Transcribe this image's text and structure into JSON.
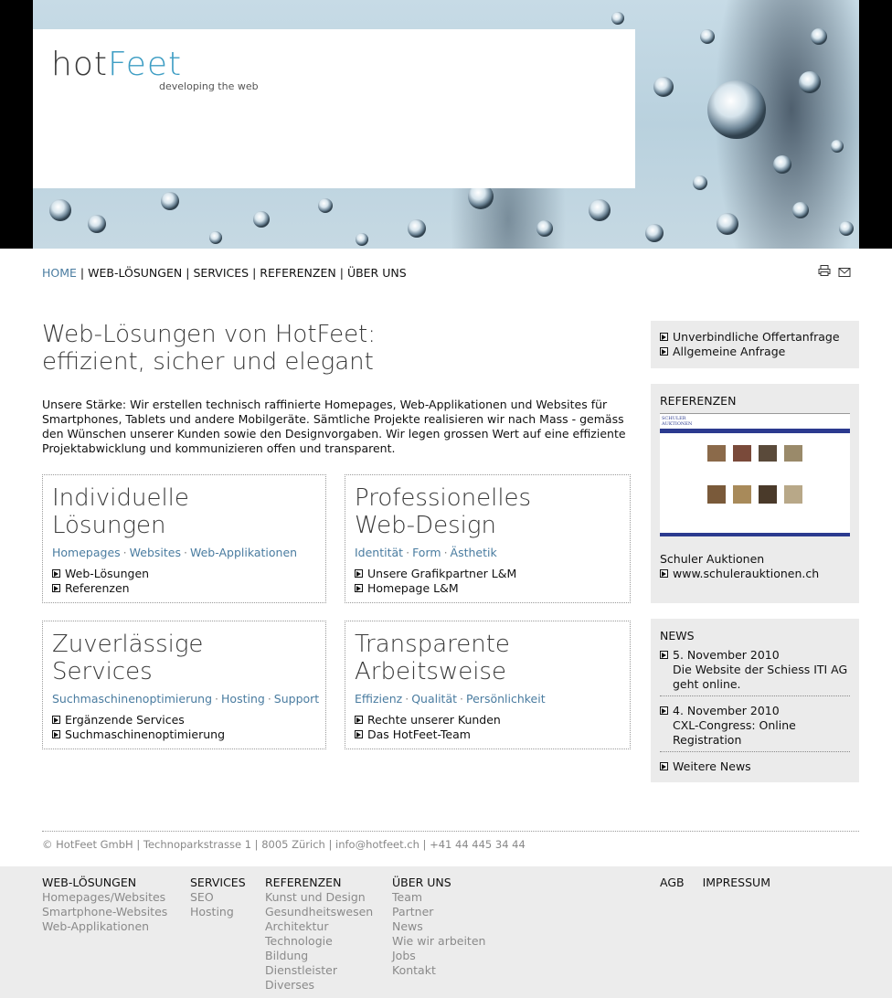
{
  "logo": {
    "hot": "hot",
    "feet": "Feet",
    "tagline": "developing the web"
  },
  "nav": {
    "items": [
      "HOME",
      "WEB-LÖSUNGEN",
      "SERVICES",
      "REFERENZEN",
      "ÜBER UNS"
    ],
    "separator": "|",
    "active_index": 0
  },
  "tools": {
    "print_icon": "printer-icon",
    "mail_icon": "mail-icon"
  },
  "main": {
    "title_line1": "Web-Lösungen von HotFeet:",
    "title_line2": "effizient, sicher und elegant",
    "intro": "Unsere Stärke: Wir erstellen technisch raffinierte Homepages, Web-Applikationen und Websites für Smartphones, Tablets und andere Mobilgeräte. Sämtliche Projekte realisieren wir nach Mass - gemäss den Wünschen unserer Kunden sowie den Designvorgaben. Wir legen grossen Wert auf eine effiziente Projektabwicklung und kommunizieren offen und transparent."
  },
  "boxes": [
    {
      "title_line1": "Individuelle",
      "title_line2": "Lösungen",
      "keywords": [
        "Homepages",
        "Websites",
        "Web-Applikationen"
      ],
      "links": [
        "Web-Lösungen",
        "Referenzen"
      ]
    },
    {
      "title_line1": "Professionelles",
      "title_line2": "Web-Design",
      "keywords": [
        "Identität",
        "Form",
        "Ästhetik"
      ],
      "links": [
        "Unsere Grafikpartner L&M",
        "Homepage L&M"
      ]
    },
    {
      "title_line1": "Zuverlässige",
      "title_line2": "Services",
      "keywords": [
        "Suchmaschinenoptimierung",
        "Hosting",
        "Support"
      ],
      "links": [
        "Ergänzende Services",
        "Suchmaschinenoptimierung"
      ]
    },
    {
      "title_line1": "Transparente",
      "title_line2": "Arbeitsweise",
      "keywords": [
        "Effizienz",
        "Qualität",
        "Persönlichkeit"
      ],
      "links": [
        "Rechte unserer Kunden",
        "Das HotFeet-Team"
      ]
    }
  ],
  "keyword_separator": "·",
  "sidebar": {
    "quick_links": [
      "Unverbindliche Offertanfrage",
      "Allgemeine Anfrage"
    ],
    "referenzen": {
      "title": "REFERENZEN",
      "thumb_label": "SCHULER AUKTIONEN",
      "client": "Schuler Auktionen",
      "url": "www.schulerauktionen.ch"
    },
    "news": {
      "title": "NEWS",
      "items": [
        {
          "date": "5. November 2010",
          "text": "Die Website der Schiess ITI AG geht online."
        },
        {
          "date": "4. November 2010",
          "text": "CXL-Congress: Online Registration"
        }
      ],
      "more": "Weitere News"
    }
  },
  "footer": {
    "address": "© HotFeet GmbH | Technoparkstrasse 1 | 8005 Zürich | info@hotfeet.ch | +41 44 445 34 44",
    "columns": [
      {
        "head": "WEB-LÖSUNGEN",
        "items": [
          "Homepages/Websites",
          "Smartphone-Websites",
          "Web-Applikationen"
        ]
      },
      {
        "head": "SERVICES",
        "items": [
          "SEO",
          "Hosting"
        ]
      },
      {
        "head": "REFERENZEN",
        "items": [
          "Kunst und Design",
          "Gesundheitswesen",
          "Architektur",
          "Technologie",
          "Bildung",
          "Dienstleister",
          "Diverses"
        ]
      },
      {
        "head": "ÜBER UNS",
        "items": [
          "Team",
          "Partner",
          "News",
          "Wie wir arbeiten",
          "Jobs",
          "Kontakt"
        ]
      }
    ],
    "legal": [
      "AGB",
      "IMPRESSUM"
    ]
  },
  "colors": {
    "accent": "#4a7ca0",
    "logo_blue": "#3f9ec4",
    "sidebar_bg": "#ebebeb",
    "footer_bg": "#ececec"
  }
}
